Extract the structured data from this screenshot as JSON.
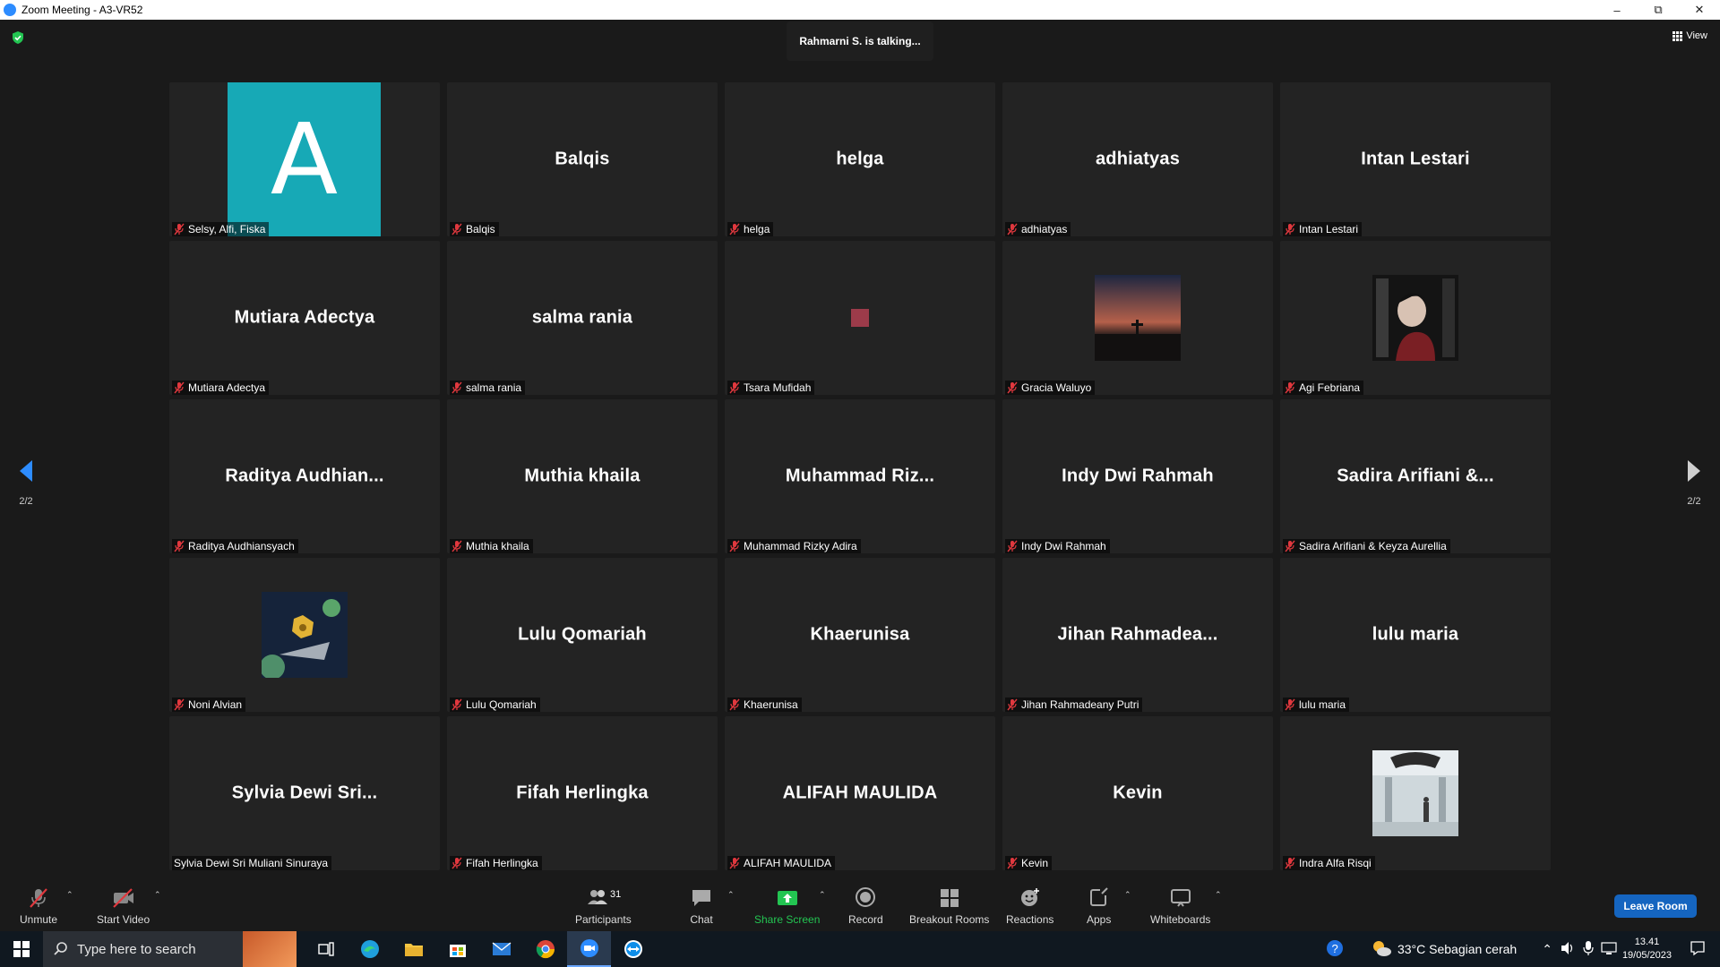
{
  "window": {
    "title": "Zoom Meeting - A3-VR52",
    "minimize": "–",
    "restore": "⧉",
    "close": "✕"
  },
  "meeting": {
    "talking": "Rahmarni S. is talking...",
    "view_label": "View",
    "page_indicator_left": "2/2",
    "page_indicator_right": "2/2"
  },
  "tiles": [
    {
      "big": "",
      "label": "Selsy, Alfi, Fiska",
      "kind": "avatar",
      "avatar_letter": "A"
    },
    {
      "big": "Balqis",
      "label": "Balqis"
    },
    {
      "big": "helga",
      "label": "helga"
    },
    {
      "big": "adhiatyas",
      "label": "adhiatyas"
    },
    {
      "big": "Intan Lestari",
      "label": "Intan Lestari"
    },
    {
      "big": "Mutiara Adectya",
      "label": "Mutiara Adectya"
    },
    {
      "big": "salma rania",
      "label": "salma rania"
    },
    {
      "big": "",
      "label": "Tsara Mufidah",
      "kind": "square"
    },
    {
      "big": "",
      "label": "Gracia Waluyo",
      "kind": "sunset"
    },
    {
      "big": "",
      "label": "Agi Febriana",
      "kind": "portrait"
    },
    {
      "big": "Raditya  Audhian...",
      "label": "Raditya Audhiansyach"
    },
    {
      "big": "Muthia khaila",
      "label": "Muthia khaila"
    },
    {
      "big": "Muhammad  Riz...",
      "label": "Muhammad Rizky Adira"
    },
    {
      "big": "Indy Dwi Rahmah",
      "label": "Indy Dwi Rahmah"
    },
    {
      "big": "Sadira  Arifiani  &...",
      "label": "Sadira Arifiani & Keyza Aurellia"
    },
    {
      "big": "",
      "label": "Noni Alvian",
      "kind": "space"
    },
    {
      "big": "Lulu Qomariah",
      "label": "Lulu Qomariah"
    },
    {
      "big": "Khaerunisa",
      "label": "Khaerunisa"
    },
    {
      "big": "Jihan  Rahmadea...",
      "label": "Jihan Rahmadeany Putri"
    },
    {
      "big": "lulu maria",
      "label": "lulu maria"
    },
    {
      "big": "Sylvia  Dewi  Sri...",
      "label": "Sylvia Dewi Sri Muliani Sinuraya",
      "unmuted": true
    },
    {
      "big": "Fifah Herlingka",
      "label": "Fifah Herlingka"
    },
    {
      "big": "ALIFAH MAULIDA",
      "label": "ALIFAH MAULIDA"
    },
    {
      "big": "Kevin",
      "label": "Kevin"
    },
    {
      "big": "",
      "label": "Indra Alfa Risqi",
      "kind": "monument"
    }
  ],
  "toolbar": {
    "unmute": "Unmute",
    "start_video": "Start Video",
    "participants": "Participants",
    "participants_count": "31",
    "chat": "Chat",
    "share_screen": "Share Screen",
    "record": "Record",
    "breakout_rooms": "Breakout Rooms",
    "reactions": "Reactions",
    "apps": "Apps",
    "whiteboards": "Whiteboards",
    "leave": "Leave Room"
  },
  "taskbar": {
    "search_placeholder": "Type here to search",
    "weather": "33°C  Sebagian cerah",
    "time": "13.41",
    "date": "19/05/2023"
  },
  "colors": {
    "share_green": "#23c552",
    "leave_blue": "#1565c0",
    "avatar_teal": "#17a9b6",
    "mute_red": "#e0383e"
  }
}
